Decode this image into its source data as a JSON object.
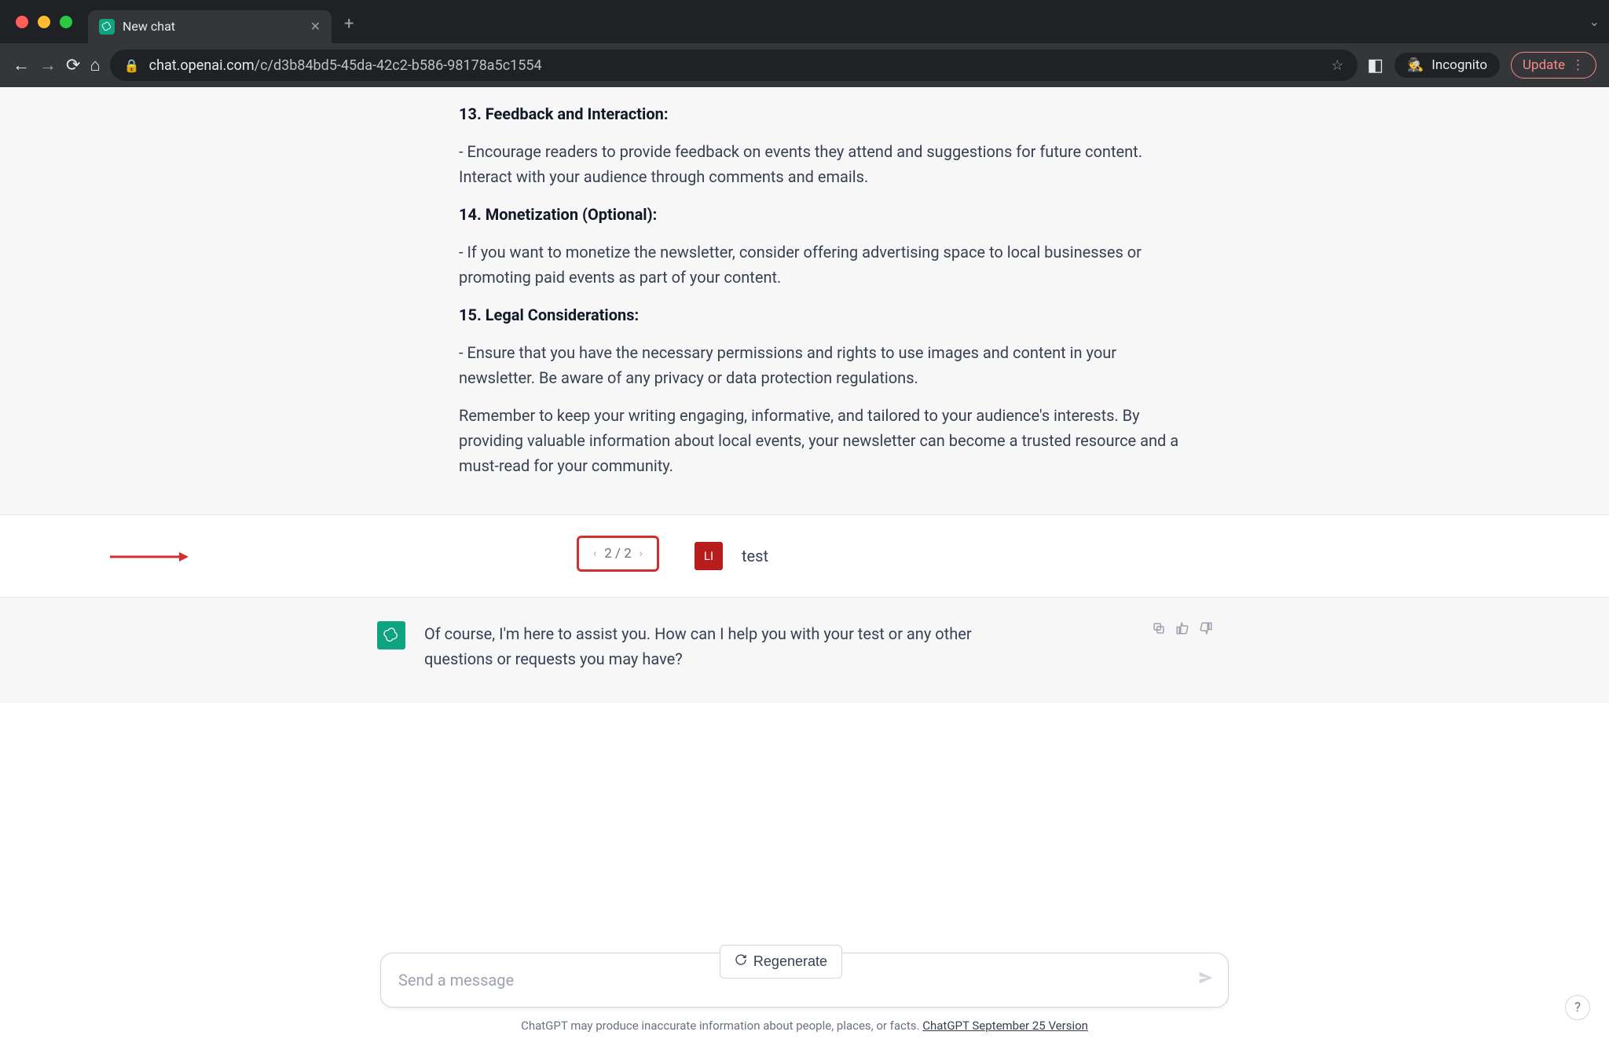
{
  "browser": {
    "tab_title": "New chat",
    "url_host": "chat.openai.com",
    "url_path": "/c/d3b84bd5-45da-42c2-b586-98178a5c1554",
    "incognito_label": "Incognito",
    "update_label": "Update"
  },
  "assistant_prev": {
    "cutoff": "…",
    "s13_title": "13. Feedback and Interaction:",
    "s13_body": "- Encourage readers to provide feedback on events they attend and suggestions for future content. Interact with your audience through comments and emails.",
    "s14_title": "14. Monetization (Optional):",
    "s14_body": "- If you want to monetize the newsletter, consider offering advertising space to local businesses or promoting paid events as part of your content.",
    "s15_title": "15. Legal Considerations:",
    "s15_body": "- Ensure that you have the necessary permissions and rights to use images and content in your newsletter. Be aware of any privacy or data protection regulations.",
    "closing": "Remember to keep your writing engaging, informative, and tailored to your audience's interests. By providing valuable information about local events, your newsletter can become a trusted resource and a must-read for your community."
  },
  "user_msg": {
    "pager": "2 / 2",
    "avatar_initials": "LI",
    "text": "test"
  },
  "assistant_reply": {
    "text": "Of course, I'm here to assist you. How can I help you with your test or any other questions or requests you may have?"
  },
  "footer": {
    "regenerate_label": "Regenerate",
    "input_placeholder": "Send a message",
    "disclaimer_prefix": "ChatGPT may produce inaccurate information about people, places, or facts. ",
    "disclaimer_link": "ChatGPT September 25 Version"
  }
}
